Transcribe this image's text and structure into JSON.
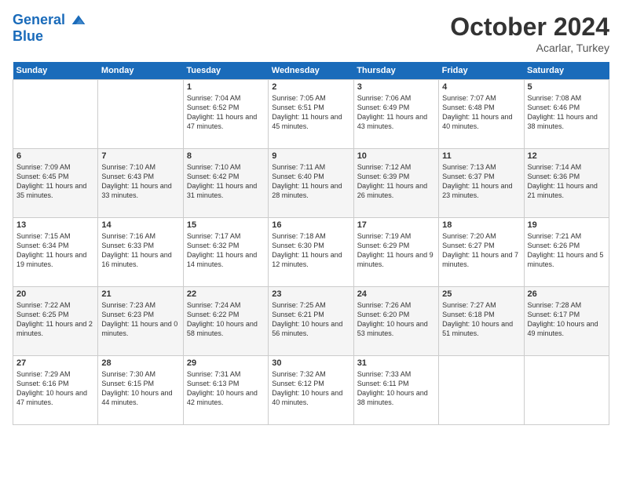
{
  "header": {
    "logo_line1": "General",
    "logo_line2": "Blue",
    "month": "October 2024",
    "location": "Acarlar, Turkey"
  },
  "weekdays": [
    "Sunday",
    "Monday",
    "Tuesday",
    "Wednesday",
    "Thursday",
    "Friday",
    "Saturday"
  ],
  "weeks": [
    [
      {
        "day": "",
        "info": ""
      },
      {
        "day": "",
        "info": ""
      },
      {
        "day": "1",
        "info": "Sunrise: 7:04 AM\nSunset: 6:52 PM\nDaylight: 11 hours and 47 minutes."
      },
      {
        "day": "2",
        "info": "Sunrise: 7:05 AM\nSunset: 6:51 PM\nDaylight: 11 hours and 45 minutes."
      },
      {
        "day": "3",
        "info": "Sunrise: 7:06 AM\nSunset: 6:49 PM\nDaylight: 11 hours and 43 minutes."
      },
      {
        "day": "4",
        "info": "Sunrise: 7:07 AM\nSunset: 6:48 PM\nDaylight: 11 hours and 40 minutes."
      },
      {
        "day": "5",
        "info": "Sunrise: 7:08 AM\nSunset: 6:46 PM\nDaylight: 11 hours and 38 minutes."
      }
    ],
    [
      {
        "day": "6",
        "info": "Sunrise: 7:09 AM\nSunset: 6:45 PM\nDaylight: 11 hours and 35 minutes."
      },
      {
        "day": "7",
        "info": "Sunrise: 7:10 AM\nSunset: 6:43 PM\nDaylight: 11 hours and 33 minutes."
      },
      {
        "day": "8",
        "info": "Sunrise: 7:10 AM\nSunset: 6:42 PM\nDaylight: 11 hours and 31 minutes."
      },
      {
        "day": "9",
        "info": "Sunrise: 7:11 AM\nSunset: 6:40 PM\nDaylight: 11 hours and 28 minutes."
      },
      {
        "day": "10",
        "info": "Sunrise: 7:12 AM\nSunset: 6:39 PM\nDaylight: 11 hours and 26 minutes."
      },
      {
        "day": "11",
        "info": "Sunrise: 7:13 AM\nSunset: 6:37 PM\nDaylight: 11 hours and 23 minutes."
      },
      {
        "day": "12",
        "info": "Sunrise: 7:14 AM\nSunset: 6:36 PM\nDaylight: 11 hours and 21 minutes."
      }
    ],
    [
      {
        "day": "13",
        "info": "Sunrise: 7:15 AM\nSunset: 6:34 PM\nDaylight: 11 hours and 19 minutes."
      },
      {
        "day": "14",
        "info": "Sunrise: 7:16 AM\nSunset: 6:33 PM\nDaylight: 11 hours and 16 minutes."
      },
      {
        "day": "15",
        "info": "Sunrise: 7:17 AM\nSunset: 6:32 PM\nDaylight: 11 hours and 14 minutes."
      },
      {
        "day": "16",
        "info": "Sunrise: 7:18 AM\nSunset: 6:30 PM\nDaylight: 11 hours and 12 minutes."
      },
      {
        "day": "17",
        "info": "Sunrise: 7:19 AM\nSunset: 6:29 PM\nDaylight: 11 hours and 9 minutes."
      },
      {
        "day": "18",
        "info": "Sunrise: 7:20 AM\nSunset: 6:27 PM\nDaylight: 11 hours and 7 minutes."
      },
      {
        "day": "19",
        "info": "Sunrise: 7:21 AM\nSunset: 6:26 PM\nDaylight: 11 hours and 5 minutes."
      }
    ],
    [
      {
        "day": "20",
        "info": "Sunrise: 7:22 AM\nSunset: 6:25 PM\nDaylight: 11 hours and 2 minutes."
      },
      {
        "day": "21",
        "info": "Sunrise: 7:23 AM\nSunset: 6:23 PM\nDaylight: 11 hours and 0 minutes."
      },
      {
        "day": "22",
        "info": "Sunrise: 7:24 AM\nSunset: 6:22 PM\nDaylight: 10 hours and 58 minutes."
      },
      {
        "day": "23",
        "info": "Sunrise: 7:25 AM\nSunset: 6:21 PM\nDaylight: 10 hours and 56 minutes."
      },
      {
        "day": "24",
        "info": "Sunrise: 7:26 AM\nSunset: 6:20 PM\nDaylight: 10 hours and 53 minutes."
      },
      {
        "day": "25",
        "info": "Sunrise: 7:27 AM\nSunset: 6:18 PM\nDaylight: 10 hours and 51 minutes."
      },
      {
        "day": "26",
        "info": "Sunrise: 7:28 AM\nSunset: 6:17 PM\nDaylight: 10 hours and 49 minutes."
      }
    ],
    [
      {
        "day": "27",
        "info": "Sunrise: 7:29 AM\nSunset: 6:16 PM\nDaylight: 10 hours and 47 minutes."
      },
      {
        "day": "28",
        "info": "Sunrise: 7:30 AM\nSunset: 6:15 PM\nDaylight: 10 hours and 44 minutes."
      },
      {
        "day": "29",
        "info": "Sunrise: 7:31 AM\nSunset: 6:13 PM\nDaylight: 10 hours and 42 minutes."
      },
      {
        "day": "30",
        "info": "Sunrise: 7:32 AM\nSunset: 6:12 PM\nDaylight: 10 hours and 40 minutes."
      },
      {
        "day": "31",
        "info": "Sunrise: 7:33 AM\nSunset: 6:11 PM\nDaylight: 10 hours and 38 minutes."
      },
      {
        "day": "",
        "info": ""
      },
      {
        "day": "",
        "info": ""
      }
    ]
  ]
}
